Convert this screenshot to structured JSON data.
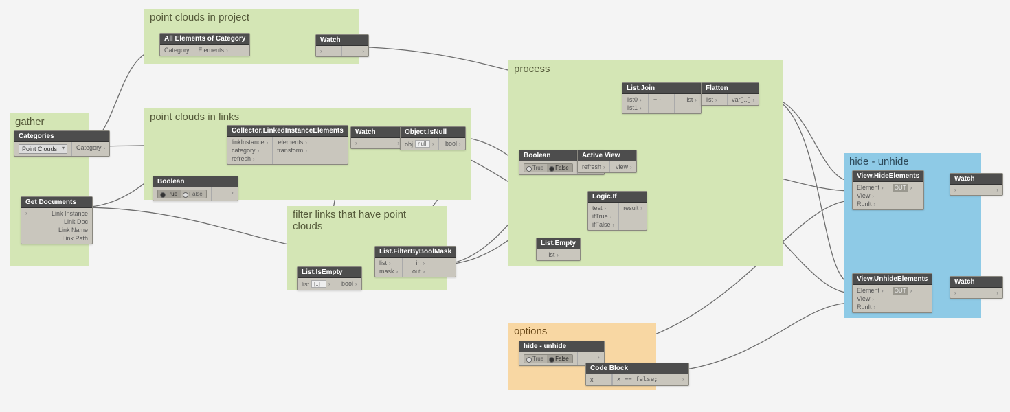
{
  "groups": {
    "gather": {
      "label": "gather"
    },
    "pc_project": {
      "label": "point clouds in project"
    },
    "pc_links": {
      "label": "point clouds in links"
    },
    "filter_links": {
      "label": "filter links that have point\nclouds"
    },
    "process": {
      "label": "process"
    },
    "options": {
      "label": "options"
    },
    "hide_unhide": {
      "label": "hide - unhide"
    }
  },
  "nodes": {
    "categories": {
      "title": "Categories",
      "dropdown_value": "Point Clouds",
      "out": "Category"
    },
    "get_documents": {
      "title": "Get Documents",
      "outputs": [
        "Link Instance",
        "Link Doc",
        "Link Name",
        "Link Path"
      ]
    },
    "all_elements_cat": {
      "title": "All Elements of Category",
      "inputs": [
        "Category"
      ],
      "outputs": [
        "Elements"
      ]
    },
    "watch1": {
      "title": "Watch"
    },
    "collector_linked": {
      "title": "Collector.LinkedInstanceElements",
      "inputs": [
        "linkInstance",
        "category",
        "refresh"
      ],
      "outputs": [
        "elements",
        "transform"
      ]
    },
    "boolean_links": {
      "title": "Boolean",
      "options": [
        "True",
        "False"
      ],
      "selected": "True"
    },
    "watch2": {
      "title": "Watch"
    },
    "object_isnull": {
      "title": "Object.IsNull",
      "inputs": [
        "obj"
      ],
      "input_field": "null",
      "outputs": [
        "bool"
      ]
    },
    "list_isempty": {
      "title": "List.IsEmpty",
      "inputs": [
        "list"
      ],
      "input_field": "[..]",
      "outputs": [
        "bool"
      ]
    },
    "list_filter_bool": {
      "title": "List.FilterByBoolMask",
      "inputs": [
        "list",
        "mask"
      ],
      "outputs": [
        "in",
        "out"
      ]
    },
    "boolean_process": {
      "title": "Boolean",
      "options": [
        "True",
        "False"
      ],
      "selected": "False"
    },
    "active_view": {
      "title": "Active View",
      "inputs": [
        "refresh"
      ],
      "outputs": [
        "view"
      ]
    },
    "logic_if": {
      "title": "Logic.If",
      "inputs": [
        "test",
        "ifTrue",
        "ifFalse"
      ],
      "outputs": [
        "result"
      ]
    },
    "list_empty": {
      "title": "List.Empty",
      "outputs": [
        "list"
      ]
    },
    "list_join": {
      "title": "List.Join",
      "inputs": [
        "list0",
        "list1"
      ],
      "outputs": [
        "list"
      ],
      "buttons": [
        "+",
        "-"
      ]
    },
    "flatten": {
      "title": "Flatten",
      "inputs": [
        "list"
      ],
      "outputs": [
        "var[]..[]"
      ]
    },
    "hide_unhide_bool": {
      "title": "hide - unhide",
      "options": [
        "True",
        "False"
      ],
      "selected": "False"
    },
    "code_block": {
      "title": "Code Block",
      "inputs": [
        "x"
      ],
      "code": "x == false;"
    },
    "view_hide": {
      "title": "View.HideElements",
      "inputs": [
        "Element",
        "View",
        "RunIt"
      ],
      "out_label": "OUT"
    },
    "view_unhide": {
      "title": "View.UnhideElements",
      "inputs": [
        "Element",
        "View",
        "RunIt"
      ],
      "out_label": "OUT"
    },
    "watch3": {
      "title": "Watch"
    },
    "watch4": {
      "title": "Watch"
    }
  }
}
